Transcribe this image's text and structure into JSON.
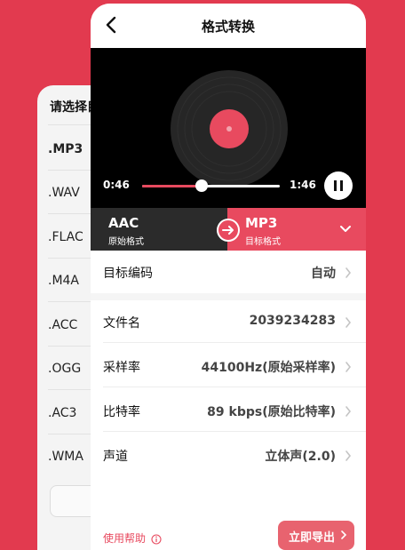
{
  "format_list": {
    "title": "请选择目",
    "items": [
      ".MP3",
      ".WAV",
      ".FLAC",
      ".M4A",
      ".ACC",
      ".OGG",
      ".AC3",
      ".WMA"
    ],
    "selected": ".MP3"
  },
  "header": {
    "title": "格式转换"
  },
  "player": {
    "current_time": "0:46",
    "total_time": "1:46",
    "progress": 0.43,
    "state": "playing"
  },
  "format": {
    "source_name": "AAC",
    "source_label": "原始格式",
    "target_name": "MP3",
    "target_label": "目标格式"
  },
  "settings": [
    {
      "label": "目标编码",
      "value": "自动"
    },
    {
      "label": "文件名",
      "value": "2039234283"
    },
    {
      "label": "采样率",
      "value": "44100Hz(原始采样率)"
    },
    {
      "label": "比特率",
      "value": "89 kbps(原始比特率)"
    },
    {
      "label": "声道",
      "value": "立体声(2.0)"
    }
  ],
  "footer": {
    "help_label": "使用帮助",
    "export_label": "立即导出"
  },
  "colors": {
    "accent": "#e84a5f",
    "background": "#e23a4f",
    "player_bg": "#000000",
    "source_bg": "#2b2b2b"
  }
}
